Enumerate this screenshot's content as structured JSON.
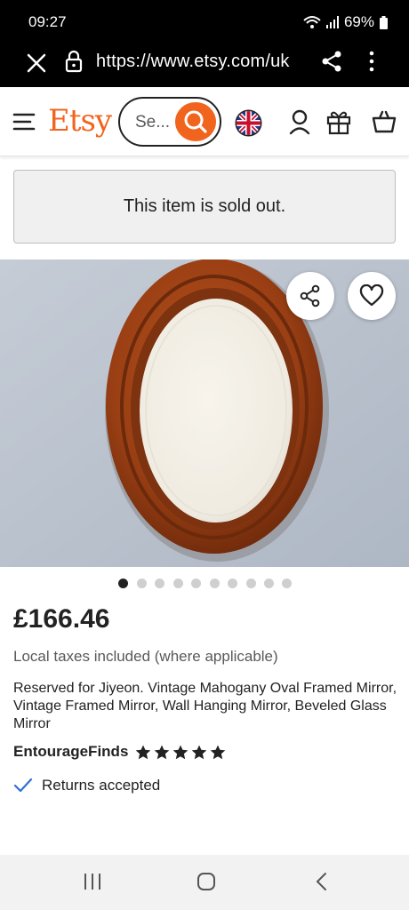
{
  "status": {
    "time": "09:27",
    "battery": "69%"
  },
  "browser": {
    "url": "https://www.etsy.com/uk"
  },
  "header": {
    "logo": "Etsy",
    "search_placeholder": "Se..."
  },
  "notice": {
    "sold_out": "This item is sold out."
  },
  "gallery": {
    "image_count": 10,
    "active_index": 0
  },
  "product": {
    "price": "£166.46",
    "taxes_note": "Local taxes included (where applicable)",
    "title": "Reserved for Jiyeon. Vintage Mahogany Oval Framed Mirror, Vintage Framed Mirror, Wall Hanging Mirror, Beveled Glass Mirror",
    "shop_name": "EntourageFinds",
    "rating": 5,
    "returns": "Returns accepted"
  },
  "icons": [
    "close-icon",
    "lock-icon",
    "share-icon",
    "more-icon",
    "menu-icon",
    "search-icon",
    "uk-flag-icon",
    "user-icon",
    "gift-icon",
    "cart-icon",
    "heart-icon",
    "check-icon",
    "star-icon",
    "recent-apps-icon",
    "home-icon",
    "back-icon"
  ],
  "colors": {
    "brand": "#f1641e",
    "text": "#222222",
    "muted": "#595959",
    "check": "#2f6fd6"
  }
}
